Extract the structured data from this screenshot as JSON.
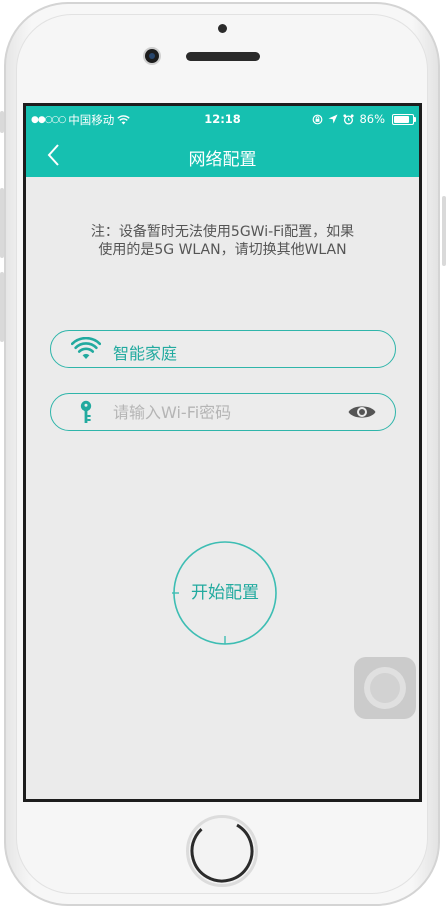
{
  "status_bar": {
    "signal": "●●○○○",
    "carrier": "中国移动",
    "time": "12:18",
    "battery_percent": "86%"
  },
  "nav": {
    "title": "网络配置",
    "back_icon": "chevron-left-icon"
  },
  "notice": {
    "line1": "注：设备暂时无法使用5GWi-Fi配置，如果",
    "line2": "使用的是5G WLAN，请切换其他WLAN"
  },
  "wifi_field": {
    "icon": "wifi-icon",
    "ssid": "智能家庭"
  },
  "password_field": {
    "icon": "key-icon",
    "placeholder": "请输入Wi-Fi密码",
    "value": "",
    "toggle_icon": "eye-icon"
  },
  "start_button": {
    "label": "开始配置"
  },
  "colors": {
    "accent": "#16c0b0",
    "accent_text": "#22aa9f",
    "background": "#ebebeb"
  }
}
